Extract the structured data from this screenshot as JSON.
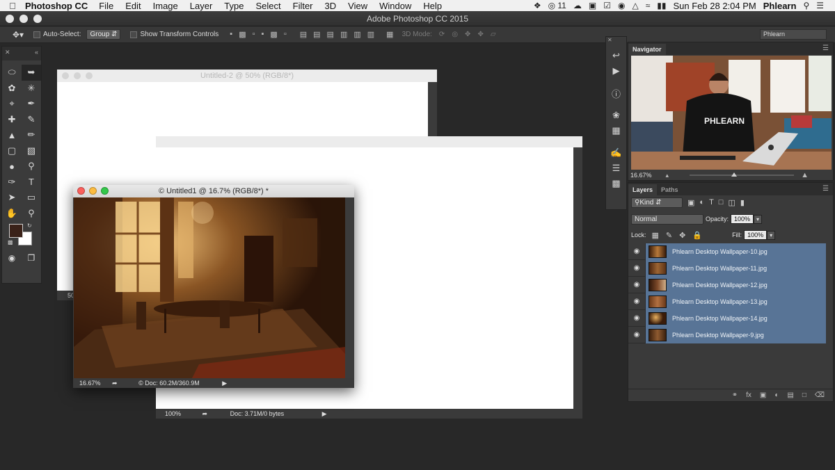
{
  "menubar": {
    "apple": "",
    "app": "Photoshop CC",
    "items": [
      "File",
      "Edit",
      "Image",
      "Layer",
      "Type",
      "Select",
      "Filter",
      "3D",
      "View",
      "Window",
      "Help"
    ],
    "badge": "11",
    "datetime": "Sun Feb 28  2:04 PM",
    "user": "Phlearn"
  },
  "app_title": "Adobe Photoshop CC 2015",
  "options": {
    "auto_select_label": "Auto-Select:",
    "auto_select_value": "Group",
    "transform_label": "Show Transform Controls",
    "mode_3d_label": "3D Mode:",
    "workspace": "Phlearn"
  },
  "colors": {
    "foreground": "#3a2219",
    "background": "#ffffff",
    "layer_selected": "#587496"
  },
  "documents": {
    "doc2": {
      "title": "Untitled-2 @ 50% (RGB/8*)",
      "status_zoom": "50"
    },
    "doc3": {
      "zoom": "100%",
      "info": "Doc: 3.71M/0 bytes"
    },
    "doc1": {
      "title": "© Untitled1 @ 16.7% (RGB/8*) *",
      "zoom": "16.67%",
      "info": "© Doc: 60.2M/360.9M"
    }
  },
  "navigator": {
    "tab": "Navigator",
    "zoom": "16.67%",
    "shirt_text": "PHLEARN"
  },
  "layers": {
    "tab_layers": "Layers",
    "tab_paths": "Paths",
    "filter_kind": "Kind",
    "blend_mode": "Normal",
    "opacity_label": "Opacity:",
    "opacity_value": "100%",
    "lock_label": "Lock:",
    "fill_label": "Fill:",
    "fill_value": "100%",
    "items": [
      {
        "name": "Phlearn Desktop Wallpaper-10.jpg"
      },
      {
        "name": "Phlearn Desktop Wallpaper-11.jpg"
      },
      {
        "name": "Phlearn Desktop Wallpaper-12.jpg"
      },
      {
        "name": "Phlearn Desktop Wallpaper-13.jpg"
      },
      {
        "name": "Phlearn Desktop Wallpaper-14.jpg"
      },
      {
        "name": "Phlearn Desktop Wallpaper-9.jpg"
      }
    ]
  }
}
